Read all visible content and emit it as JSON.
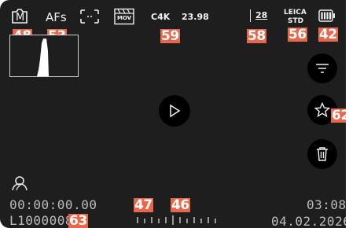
{
  "top_bar": {
    "mode_label": "M",
    "focus_mode": "AFs",
    "format_label": "MOV",
    "resolution": "C4K",
    "frame_rate": "23.98",
    "focal_length": "28",
    "look_line1": "LEICA",
    "look_line2": "STD"
  },
  "timecode": "00:00:00.00",
  "file_name": "L1000008",
  "duration": "03:08",
  "date": "04.02.2026",
  "battery_level": 1.0,
  "callouts": {
    "mode": "48",
    "focus": "53",
    "resolution": "59",
    "focal": "58",
    "look": "56",
    "battery": "42",
    "star": "62",
    "file": "63",
    "scale_a": "47",
    "scale_b": "46"
  },
  "icons": {
    "stabilization": "stabilization-frame-icon",
    "format": "film-clapper-icon",
    "filter": "filter-icon",
    "play": "play-icon",
    "favorite": "star-icon",
    "delete": "trash-icon",
    "face": "face-detect-icon"
  },
  "colors": {
    "callout": "#e8674a",
    "screen": "#1e1e1e",
    "button": "#000000"
  }
}
